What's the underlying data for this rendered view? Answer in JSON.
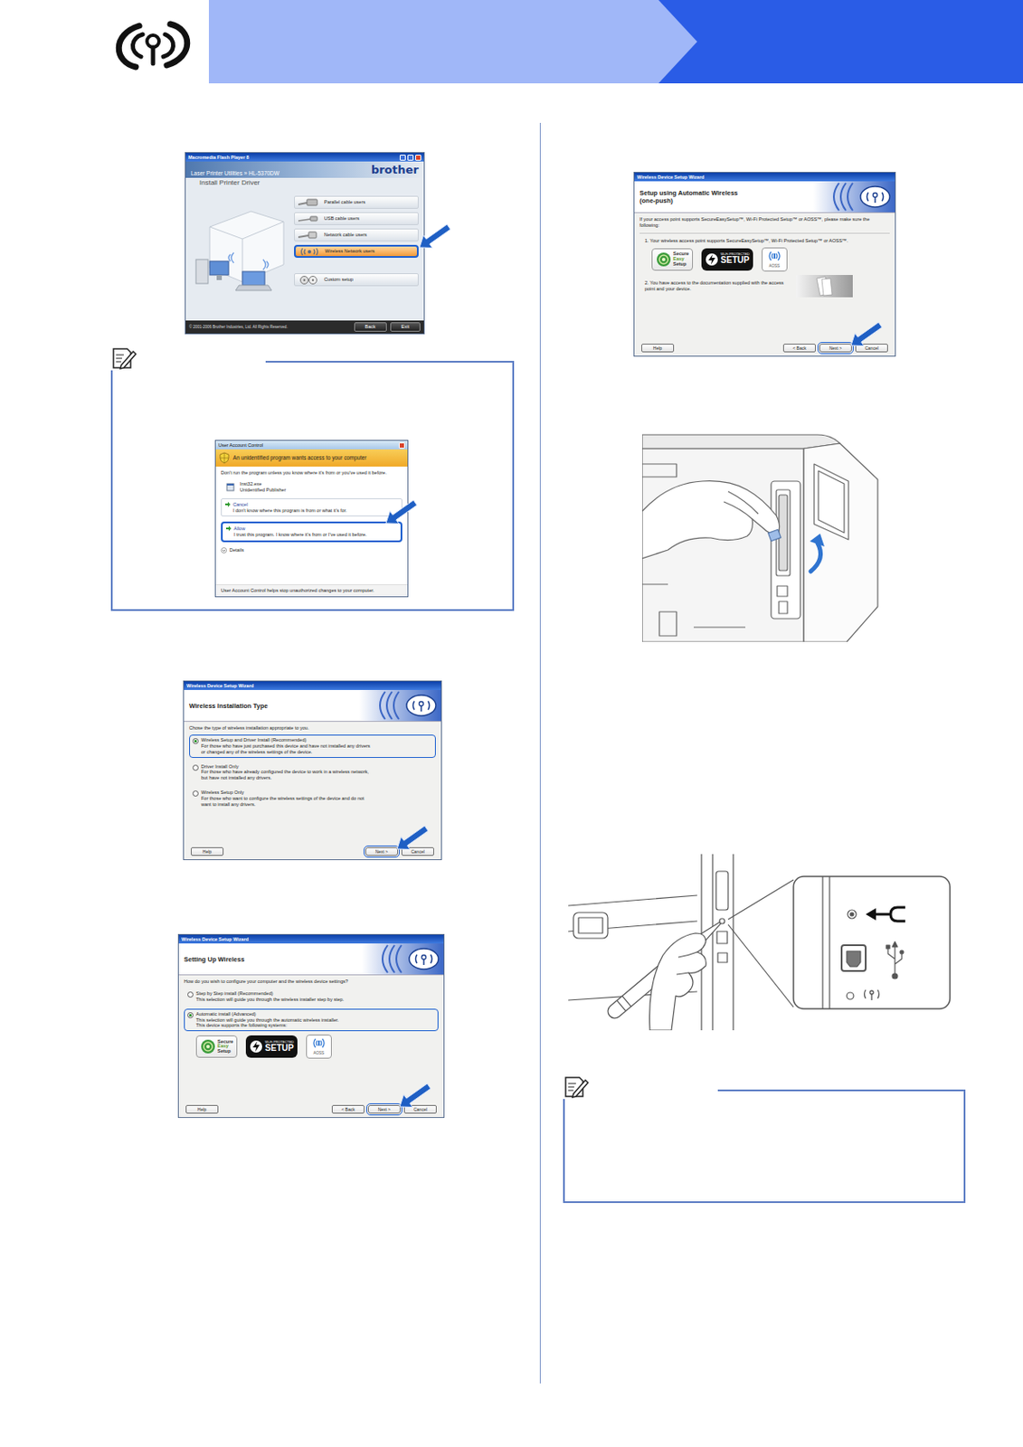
{
  "flash_window": {
    "title": "Macromedia Flash Player 8",
    "product": "Laser Printer Utilities » HL-5370DW",
    "brand": "brother",
    "section": "Install Printer Driver",
    "options": [
      {
        "label": "Parallel cable users",
        "kind": "parallel",
        "selected": false
      },
      {
        "label": "USB cable users",
        "kind": "usb",
        "selected": false
      },
      {
        "label": "Network cable users",
        "kind": "network",
        "selected": false
      },
      {
        "label": "Wireless Network users",
        "kind": "wireless",
        "selected": true
      },
      {
        "label": "Custom setup",
        "kind": "custom",
        "selected": false
      }
    ],
    "copyright": "© 2001-2006 Brother Industries, Ltd. All Rights Reserved.",
    "buttons": [
      "Back",
      "Exit"
    ]
  },
  "uac_dialog": {
    "title": "User Account Control",
    "warning": "An unidentified program wants access to your computer",
    "advice": "Don't run the program unless you know where it's from or you've used it before.",
    "program": "Inst32.exe",
    "publisher": "Unidentified Publisher",
    "choices": [
      {
        "label": "Cancel",
        "detail": "I don't know where this program is from or what it's for.",
        "selected": false
      },
      {
        "label": "Allow",
        "detail": "I trust this program. I know where it's from or I've used it before.",
        "selected": true
      }
    ],
    "details": "Details",
    "footer": "User Account Control helps stop unauthorized changes to your computer."
  },
  "wizards": [
    {
      "title": "Wireless Device Setup Wizard",
      "heading": [
        "Wireless Installation Type"
      ],
      "intro": "Chose the type of wireless installation appropriate to you.",
      "blocks": [
        {
          "kind": "radio",
          "label": "Wireless Setup and Driver Install (Recommended)",
          "lines": [
            "For those who have just purchased this device and have not installed any drivers or changed any of the wireless settings of the device."
          ],
          "selected": true
        },
        {
          "kind": "radio",
          "label": "Driver Install Only",
          "lines": [
            "For those who have already configured the device to work in a wireless network, but have not installed any drivers."
          ],
          "selected": false
        },
        {
          "kind": "radio",
          "label": "Wireless Setup Only",
          "lines": [
            "For those who want to configure the wireless settings of the device and do not want to install any drivers."
          ],
          "selected": false
        }
      ],
      "buttons": [
        {
          "label": "Help",
          "highlighted": false
        },
        {
          "label": "Next >",
          "highlighted": true
        },
        {
          "label": "Cancel",
          "highlighted": false
        }
      ]
    },
    {
      "title": "Wireless Device Setup Wizard",
      "heading": [
        "Setting Up Wireless"
      ],
      "intro": "How do you wish to configure your computer and the wireless device settings?",
      "blocks": [
        {
          "kind": "radio",
          "label": "Step by Step install (Recommended)",
          "lines": [
            "This selection will guide you through the wireless installer step by step."
          ],
          "selected": false
        },
        {
          "kind": "radio",
          "label": "Automatic install (Advanced)",
          "lines": [
            "This selection will guide you through the automatic wireless installer.",
            "This device supports the following systems:"
          ],
          "selected": true
        },
        {
          "kind": "logos",
          "items": [
            {
              "kind": "ses",
              "lines": [
                "Secure",
                "Easy",
                "Setup"
              ]
            },
            {
              "kind": "wps",
              "lines": [
                "Wi-Fi PROTECTED",
                "SETUP"
              ]
            },
            {
              "kind": "aoss",
              "lines": [
                "AOSS"
              ]
            }
          ]
        }
      ],
      "buttons": [
        {
          "label": "Help",
          "highlighted": false
        },
        {
          "label": "< Back",
          "highlighted": false
        },
        {
          "label": "Next >",
          "highlighted": true
        },
        {
          "label": "Cancel",
          "highlighted": false
        }
      ]
    },
    {
      "title": "Wireless Device Setup Wizard",
      "heading": [
        "Setup using Automatic Wireless",
        "(one-push)"
      ],
      "intro": "If your access point supports SecureEasySetup™, Wi-Fi Protected Setup™ or AOSS™, please make sure the following:",
      "blocks": [
        {
          "kind": "text",
          "lines": [
            "1. Your wireless access point supports SecureEasySetup™, Wi-Fi Protected Setup™ or AOSS™."
          ]
        },
        {
          "kind": "logos",
          "items": [
            {
              "kind": "ses",
              "lines": [
                "Secure",
                "Easy",
                "Setup"
              ]
            },
            {
              "kind": "wps",
              "lines": [
                "Wi-Fi PROTECTED",
                "SETUP"
              ]
            },
            {
              "kind": "aoss",
              "lines": [
                "AOSS"
              ]
            }
          ]
        },
        {
          "kind": "doc",
          "lines": [
            "2. You have access to the documentation supplied with the access point and your device."
          ]
        }
      ],
      "buttons": [
        {
          "label": "Help",
          "highlighted": false
        },
        {
          "label": "< Back",
          "highlighted": false
        },
        {
          "label": "Next >",
          "highlighted": true
        },
        {
          "label": "Cancel",
          "highlighted": false
        }
      ]
    }
  ]
}
